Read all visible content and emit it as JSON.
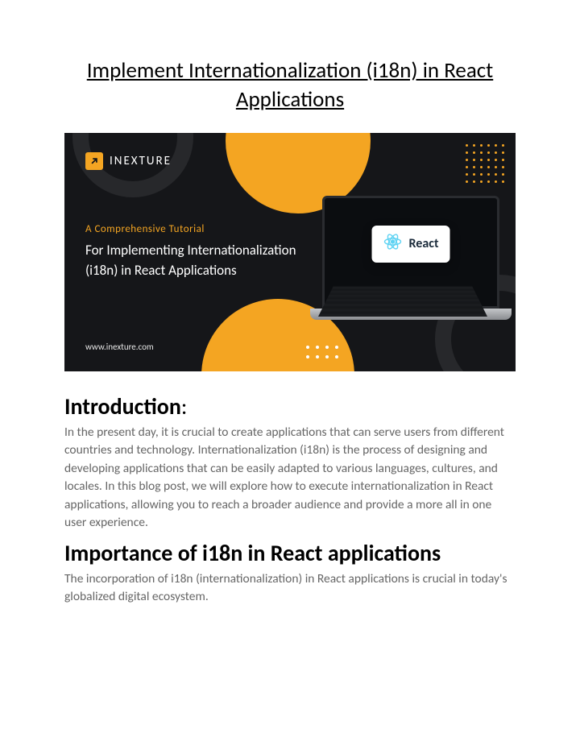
{
  "title": "Implement Internationalization (i18n) in React Applications",
  "banner": {
    "brand_name": "INEXTURE",
    "tagline": "A Comprehensive Tutorial",
    "headline": "For Implementing Internationalization (i18n) in React Applications",
    "website": "www.inexture.com",
    "react_label": "React"
  },
  "intro": {
    "heading": "Introduction",
    "colon": ":",
    "body": "In the present day, it is crucial to create applications that can serve users from different countries and technology. Internationalization (i18n) is the process of designing and developing applications that can be easily adapted to various languages, cultures, and locales. In this blog post, we will explore how to execute internationalization in React applications, allowing you to reach a broader audience and provide a more all in one user experience."
  },
  "importance": {
    "heading": "Importance of i18n in React applications",
    "body": "The incorporation of i18n (internationalization) in React applications is crucial in today's globalized digital ecosystem."
  }
}
